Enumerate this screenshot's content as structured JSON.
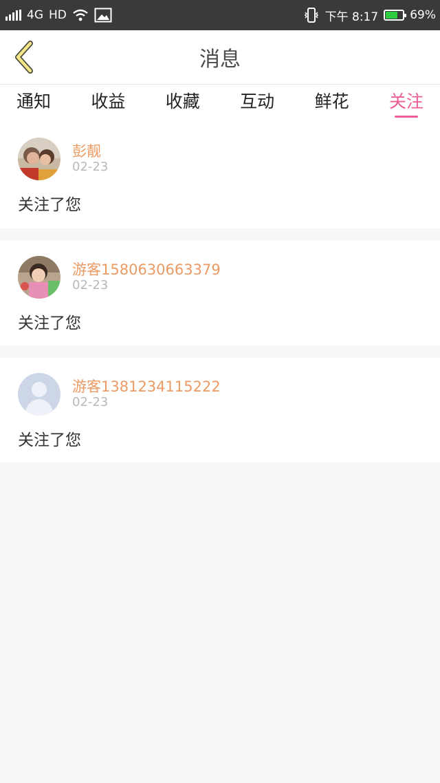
{
  "status_bar": {
    "network": "4G",
    "hd": "HD",
    "time": "下午 8:17",
    "battery": "69%",
    "battery_level": 0.69
  },
  "header": {
    "title": "消息",
    "back_icon": "chevron-left-icon"
  },
  "tabs": [
    {
      "label": "通知",
      "active": false
    },
    {
      "label": "收益",
      "active": false
    },
    {
      "label": "收藏",
      "active": false
    },
    {
      "label": "互动",
      "active": false
    },
    {
      "label": "鲜花",
      "active": false
    },
    {
      "label": "关注",
      "active": true
    }
  ],
  "notifications": [
    {
      "name": "彭靓",
      "date": "02-23",
      "message": "关注了您"
    },
    {
      "name": "游客1580630663379",
      "date": "02-23",
      "message": "关注了您"
    },
    {
      "name": "游客1381234115222",
      "date": "02-23",
      "message": "关注了您"
    }
  ],
  "colors": {
    "accent": "#ee5c97",
    "username": "#eb9a63",
    "back_arrow": "#f5e68a"
  }
}
